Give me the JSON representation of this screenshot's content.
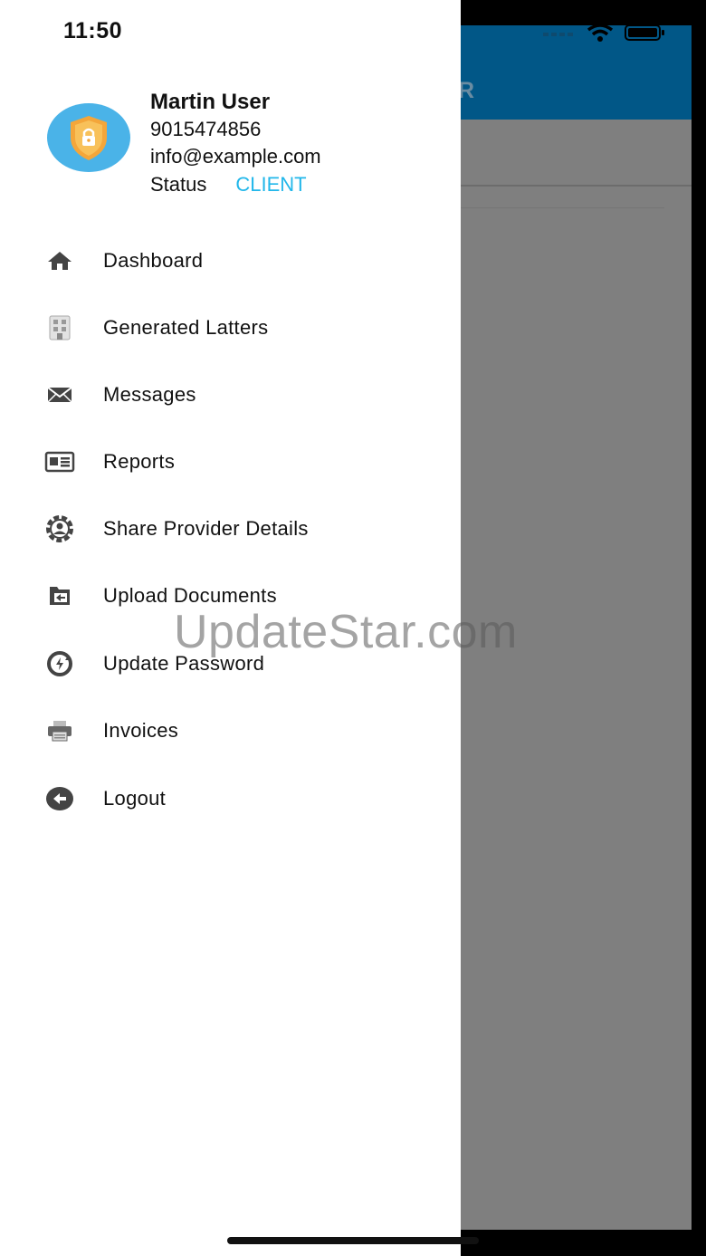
{
  "status_bar": {
    "time": "11:50"
  },
  "background_app": {
    "header_title_fragment": "R"
  },
  "profile": {
    "name": "Martin User",
    "phone": "9015474856",
    "email": "info@example.com",
    "status_label": "Status",
    "status_value": "CLIENT"
  },
  "menu": {
    "items": [
      {
        "label": "Dashboard",
        "icon": "home-icon"
      },
      {
        "label": "Generated Latters",
        "icon": "building-icon"
      },
      {
        "label": "Messages",
        "icon": "envelope-icon"
      },
      {
        "label": "Reports",
        "icon": "newspaper-icon"
      },
      {
        "label": "Share Provider Details",
        "icon": "user-gear-icon"
      },
      {
        "label": "Upload Documents",
        "icon": "folder-upload-icon"
      },
      {
        "label": "Update Password",
        "icon": "lock-refresh-icon"
      },
      {
        "label": "Invoices",
        "icon": "printer-icon"
      },
      {
        "label": "Logout",
        "icon": "logout-icon"
      }
    ]
  },
  "watermark": "UpdateStar.com",
  "colors": {
    "accent": "#22b7ea",
    "header_blue": "#015787",
    "scrim": "#7f7f7f",
    "avatar_bg": "#4ab3e8",
    "shield_orange": "#f4a63a"
  }
}
